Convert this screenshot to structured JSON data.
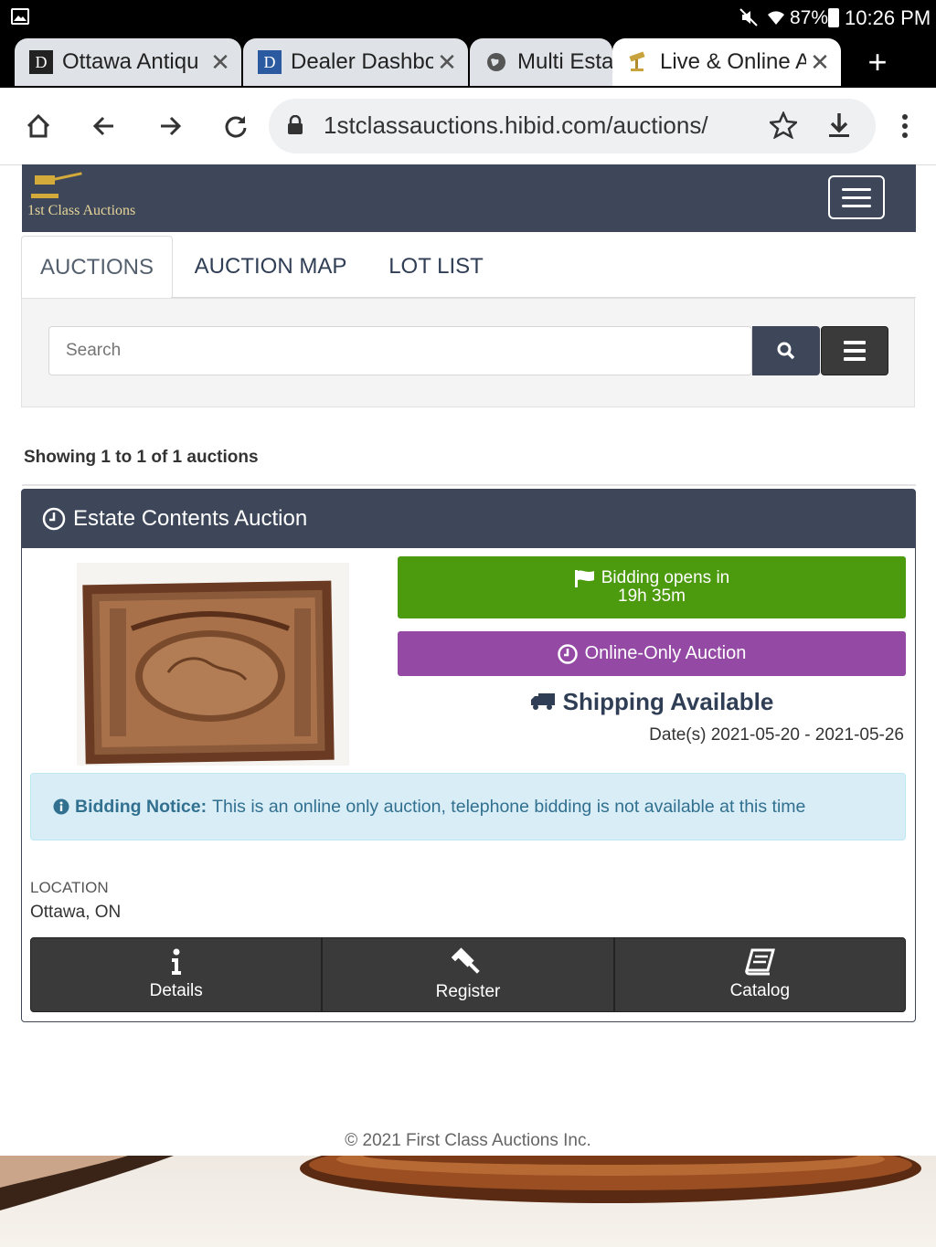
{
  "status_bar": {
    "battery": "87%",
    "time": "10:26 PM"
  },
  "browser": {
    "tabs": [
      {
        "label": "Ottawa Antiqu",
        "active": false
      },
      {
        "label": "Dealer Dashbo",
        "active": false
      },
      {
        "label": "Multi Esta",
        "active": false
      },
      {
        "label": "Live & Online A",
        "active": true
      }
    ],
    "url": "1stclassauctions.hibid.com/auctions/"
  },
  "site": {
    "logo_text": "1st Class Auctions",
    "nav_tabs": [
      "AUCTIONS",
      "AUCTION MAP",
      "LOT LIST"
    ],
    "search_placeholder": "Search",
    "showing_text": "Showing 1 to 1 of 1 auctions"
  },
  "auction": {
    "title": "Estate Contents Auction",
    "bidding_line1": "Bidding opens in",
    "bidding_line2": "19h 35m",
    "type": "Online-Only Auction",
    "shipping": "Shipping Available",
    "dates": "Date(s) 2021-05-20 - 2021-05-26",
    "notice_label": "Bidding Notice:",
    "notice_text": "This is an online only auction, telephone bidding is not available at this time",
    "location_label": "LOCATION",
    "location_value": "Ottawa, ON",
    "actions": [
      "Details",
      "Register",
      "Catalog"
    ]
  },
  "footer": {
    "copyright": "© 2021 First Class Auctions Inc."
  },
  "colors": {
    "header": "#3d4759",
    "bid_green": "#4c9a0e",
    "online_purple": "#944aa4",
    "notice_bg": "#d9edf7",
    "notice_text": "#31708f"
  }
}
